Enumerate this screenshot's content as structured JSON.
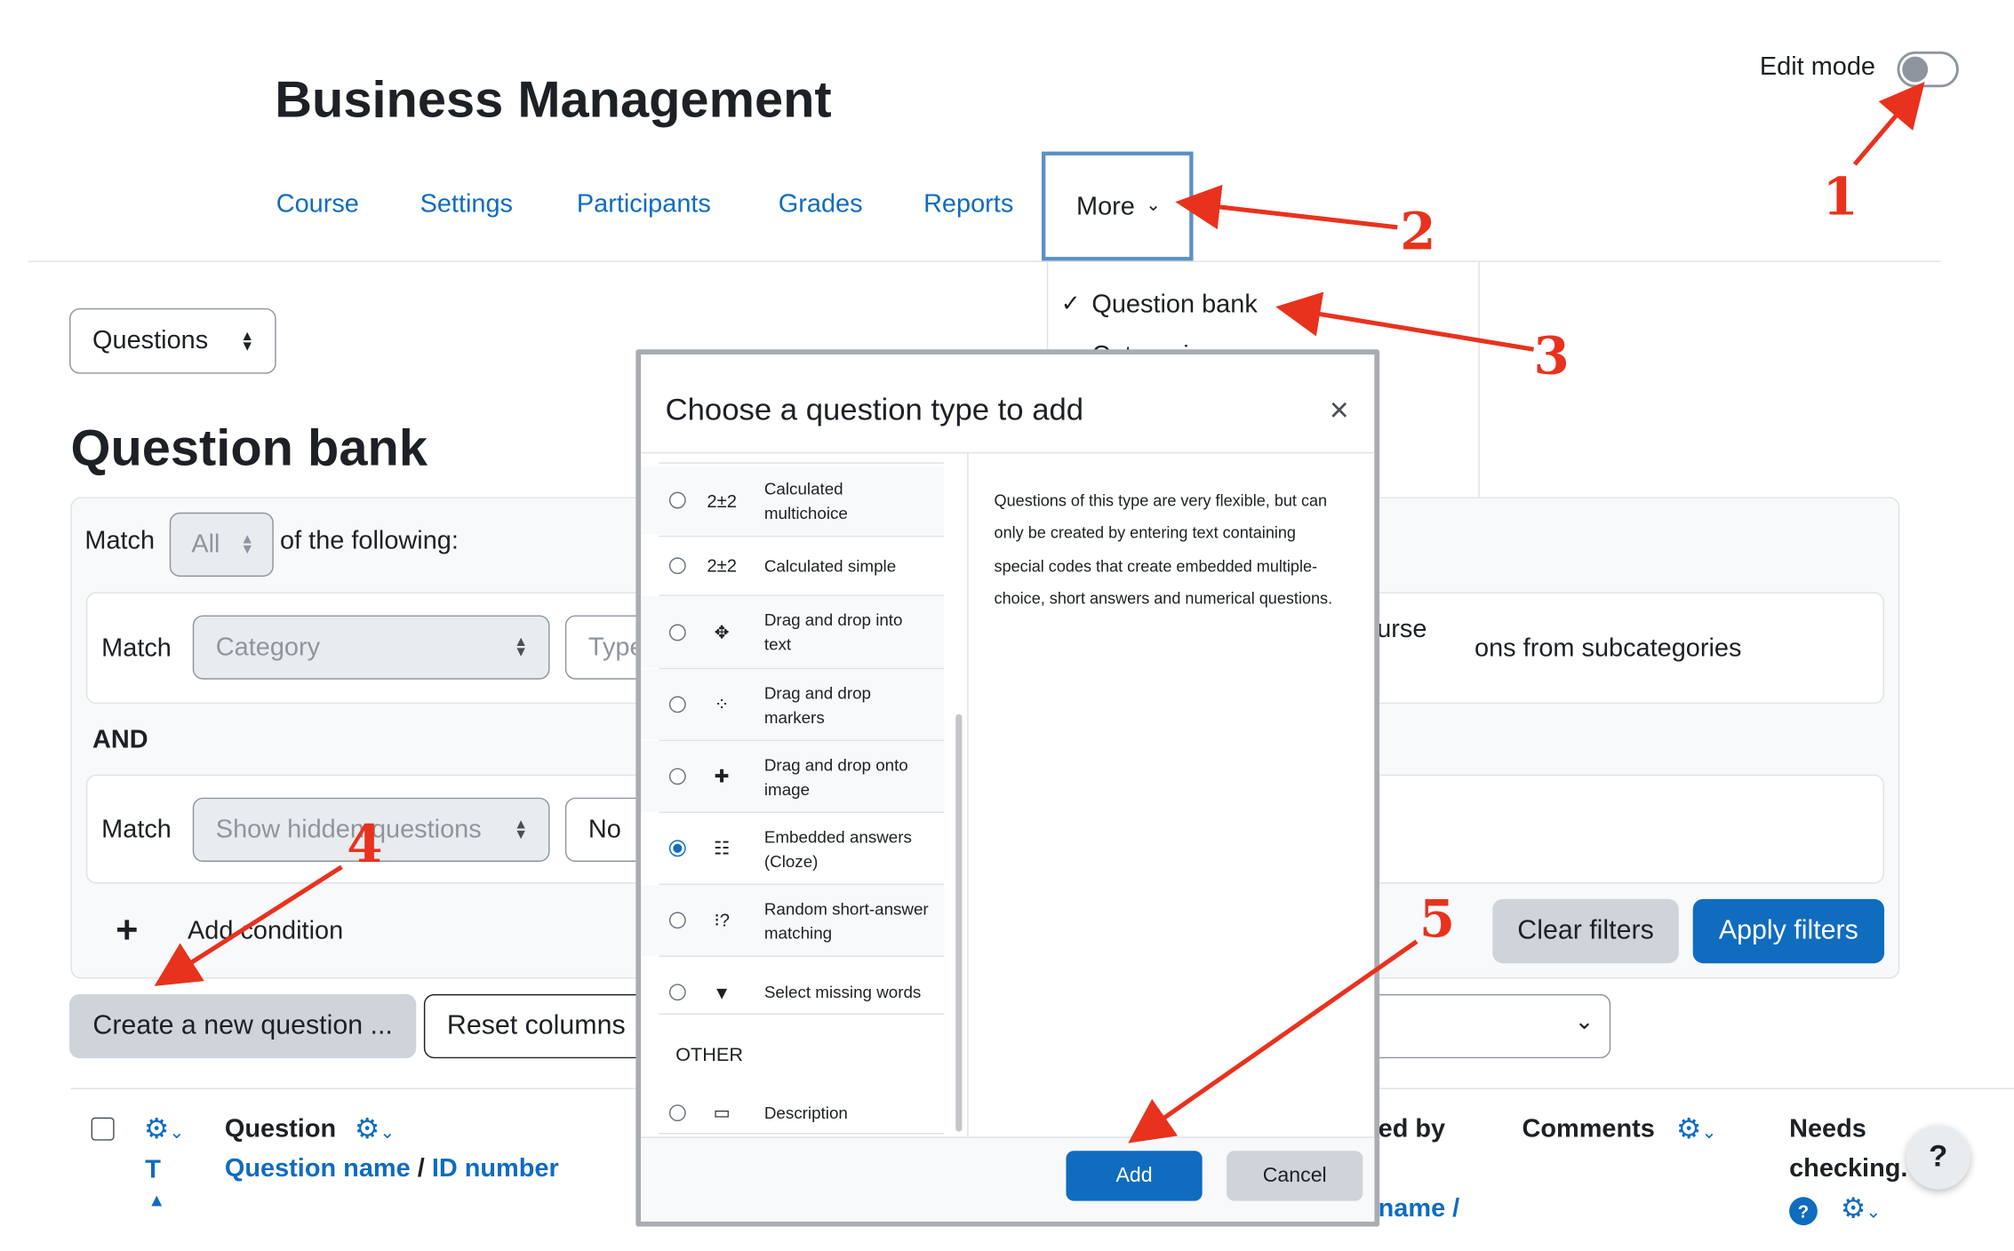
{
  "header": {
    "course_title": "Business Management",
    "edit_mode_label": "Edit mode"
  },
  "nav": {
    "items": [
      "Course",
      "Settings",
      "Participants",
      "Grades",
      "Reports"
    ],
    "more_label": "More"
  },
  "more_menu": {
    "items": [
      "Question bank",
      "Categories"
    ],
    "partial_text": [
      "urse",
      "ons from subcategories"
    ]
  },
  "sidebar_select": {
    "value": "Questions"
  },
  "page": {
    "title": "Question bank"
  },
  "filters": {
    "match_label": "Match",
    "match_value": "All",
    "of_following": "of the following:",
    "row1": {
      "match": "Match",
      "select": "Category",
      "type_partial": "Type"
    },
    "and_label": "AND",
    "row2": {
      "match": "Match",
      "select": "Show hidden questions",
      "value_partial": "No"
    },
    "add_condition": "Add condition",
    "clear": "Clear filters",
    "apply": "Apply filters"
  },
  "actions": {
    "create": "Create a new question ...",
    "reset": "Reset columns"
  },
  "table": {
    "question": "Question",
    "question_name": "Question name",
    "slash": "/",
    "id_number": "ID number",
    "t_label": "T",
    "created_by": "ed by",
    "name_partial": "name /",
    "comments": "Comments",
    "needs": "Needs",
    "checking": "checking."
  },
  "modal": {
    "title": "Choose a question type to add",
    "close": "×",
    "types": [
      {
        "label": "Calculated multichoice",
        "icon": "calculated-icon",
        "selected": false
      },
      {
        "label": "Calculated simple",
        "icon": "calculated-icon",
        "selected": false
      },
      {
        "label": "Drag and drop into text",
        "icon": "move-icon",
        "selected": false
      },
      {
        "label": "Drag and drop markers",
        "icon": "markers-icon",
        "selected": false
      },
      {
        "label": "Drag and drop onto image",
        "icon": "move-icon",
        "selected": false
      },
      {
        "label": "Embedded answers (Cloze)",
        "icon": "cloze-icon",
        "selected": true
      },
      {
        "label": "Random short-answer matching",
        "icon": "random-icon",
        "selected": false
      },
      {
        "label": "Select missing words",
        "icon": "caret-down-icon",
        "selected": false
      }
    ],
    "other_heading": "OTHER",
    "other": [
      {
        "label": "Description",
        "icon": "description-icon",
        "selected": false
      }
    ],
    "description": "Questions of this type are very flexible, but can only be created by entering text containing special codes that create embedded multiple-choice, short answers and numerical questions.",
    "add": "Add",
    "cancel": "Cancel"
  },
  "annotations": [
    "1",
    "2",
    "3",
    "4",
    "5"
  ],
  "colors": {
    "primary": "#0f6cbf",
    "annotation": "#e8321e",
    "secondary_btn": "#ced4da"
  }
}
